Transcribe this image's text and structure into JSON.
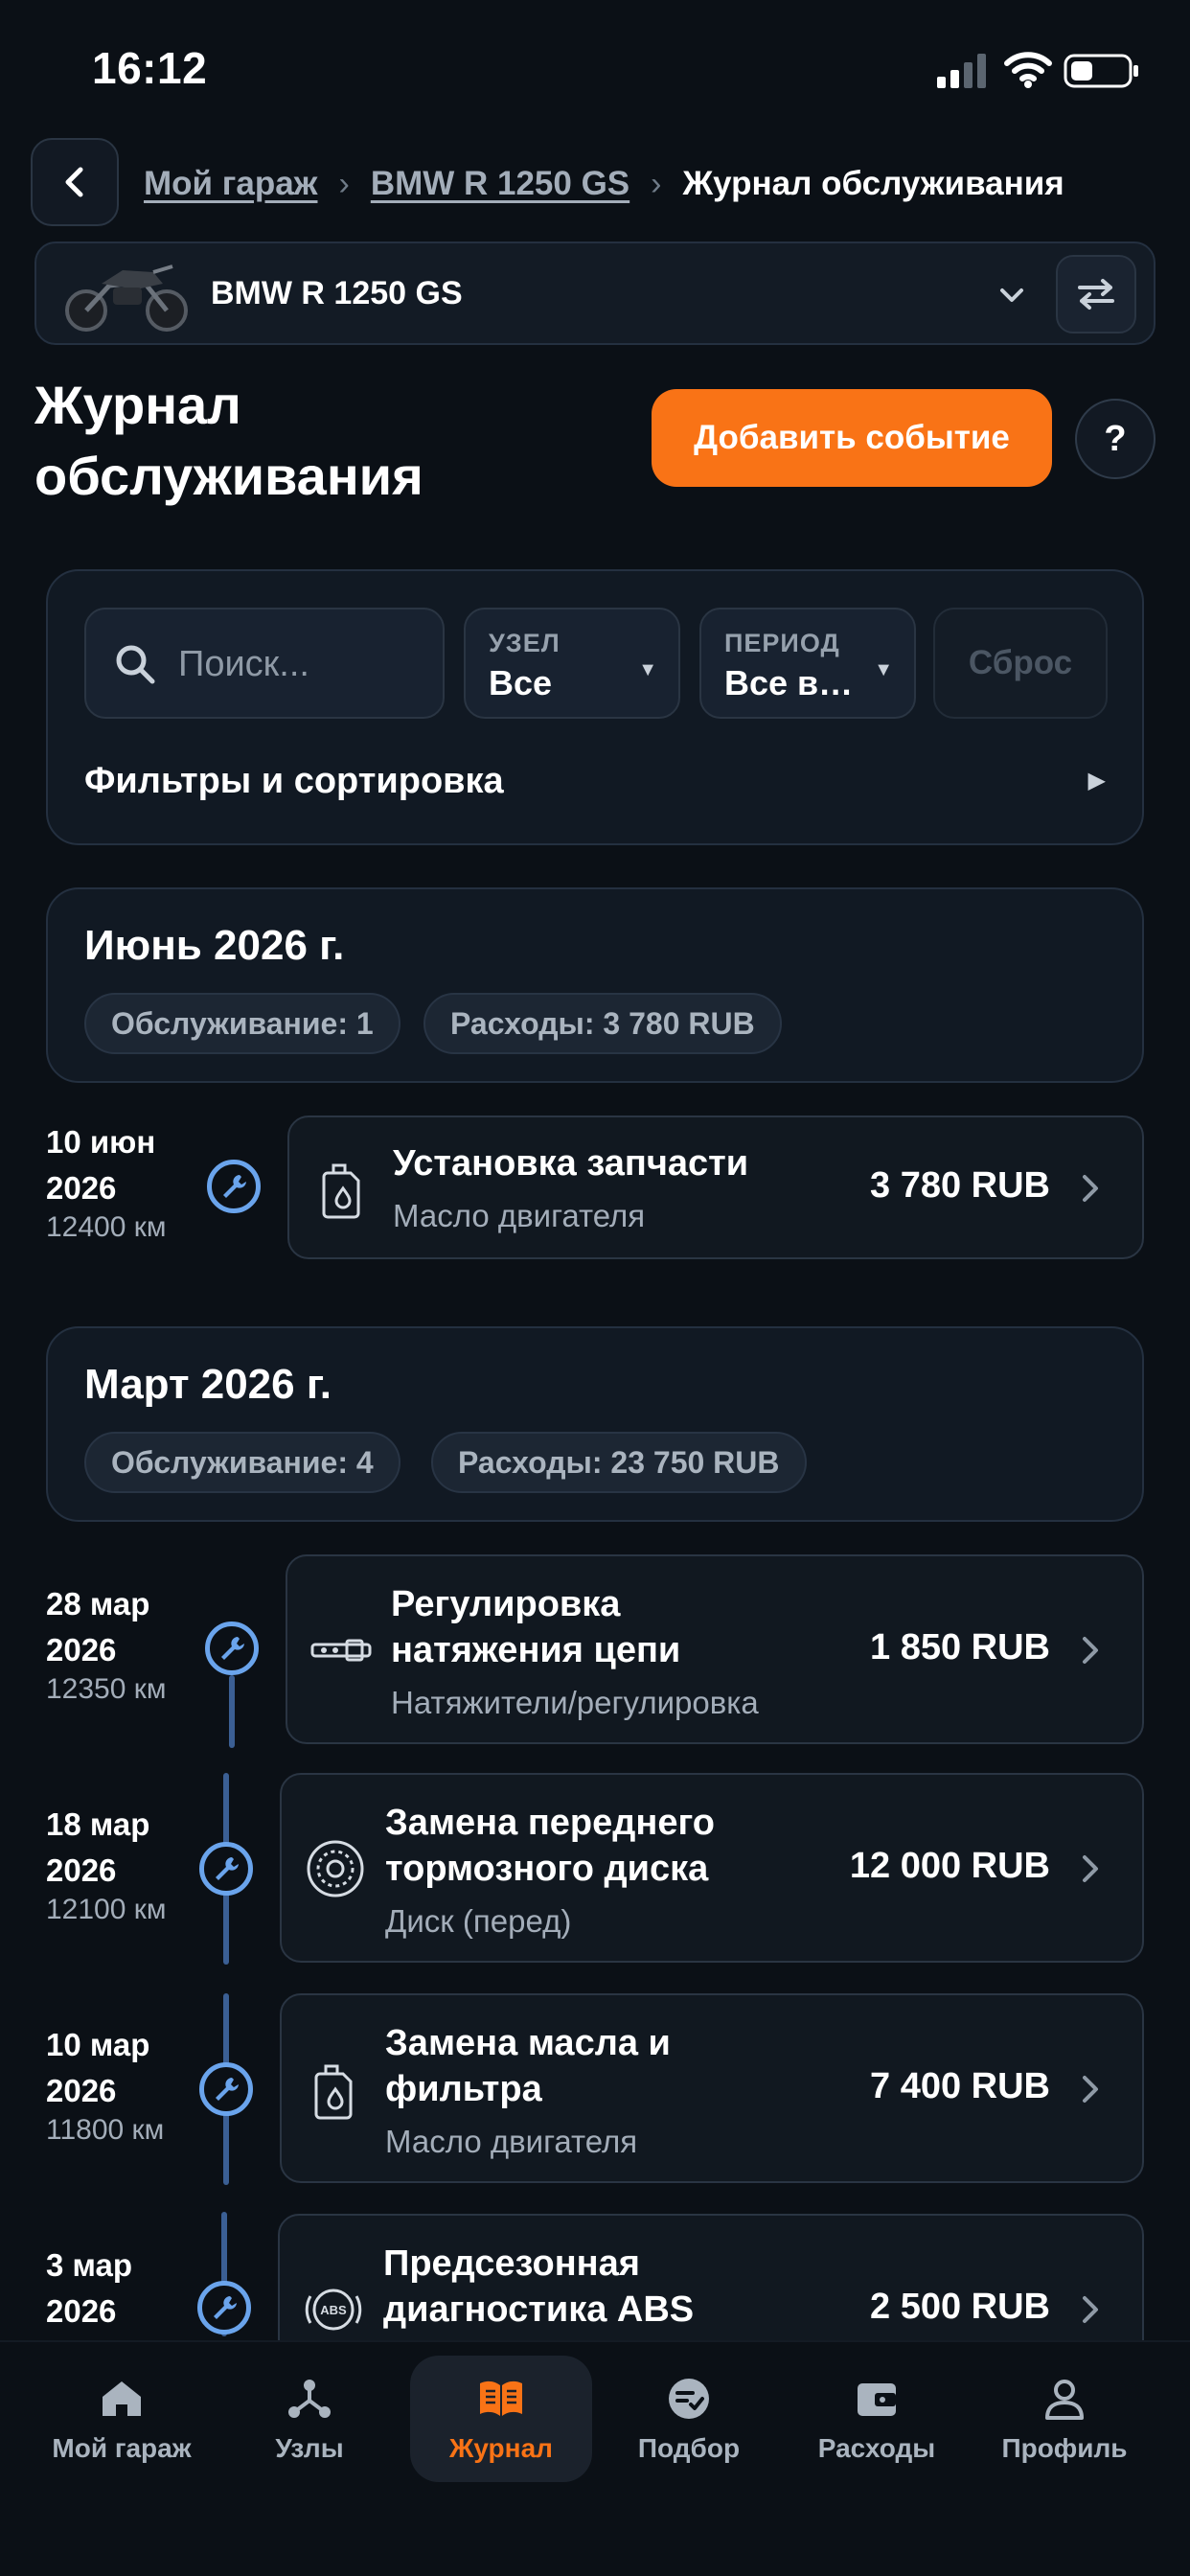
{
  "status_bar": {
    "time": "16:12"
  },
  "breadcrumb": {
    "items": [
      "Мой гараж",
      "BMW R 1250 GS"
    ],
    "current": "Журнал обслуживания",
    "separator": "›"
  },
  "bike": {
    "name": "BMW R 1250 GS"
  },
  "header": {
    "title": "Журнал обслуживания",
    "add_label": "Добавить событие",
    "help_label": "?"
  },
  "filters": {
    "search_placeholder": "Поиск...",
    "node": {
      "label": "УЗЕЛ",
      "value": "Все"
    },
    "period": {
      "label": "ПЕРИОД",
      "value": "Все в…"
    },
    "reset_label": "Сброс",
    "toggle_label": "Фильтры и сортировка"
  },
  "months": [
    {
      "title": "Июнь 2026 г.",
      "service": "Обслуживание: 1",
      "expenses": "Расходы: 3 780 RUB",
      "events": [
        {
          "date": "10 июн",
          "year": "2026",
          "km": "12400 км",
          "title": "Установка запчасти",
          "subtitle": "Масло двигателя",
          "amount": "3 780 RUB",
          "icon": "oil-can-icon"
        }
      ]
    },
    {
      "title": "Март 2026 г.",
      "service": "Обслуживание: 4",
      "expenses": "Расходы: 23 750 RUB",
      "events": [
        {
          "date": "28 мар",
          "year": "2026",
          "km": "12350 км",
          "title_1": "Регулировка",
          "title_2": "натяжения цепи",
          "subtitle": "Натяжители/регулировка",
          "amount": "1 850 RUB",
          "icon": "chain-tensioner-icon"
        },
        {
          "date": "18 мар",
          "year": "2026",
          "km": "12100 км",
          "title_1": "Замена переднего",
          "title_2": "тормозного диска",
          "subtitle": "Диск (перед)",
          "amount": "12 000 RUB",
          "icon": "brake-disc-icon"
        },
        {
          "date": "10 мар",
          "year": "2026",
          "km": "11800 км",
          "title_1": "Замена масла и",
          "title_2": "фильтра",
          "subtitle": "Масло двигателя",
          "amount": "7 400 RUB",
          "icon": "oil-can-icon"
        },
        {
          "date": "3 мар",
          "year": "2026",
          "km": "",
          "title_1": "Предсезонная",
          "title_2": "диагностика ABS",
          "subtitle": "",
          "amount": "2 500 RUB",
          "icon": "abs-icon",
          "icon_label": "ABS"
        }
      ]
    }
  ],
  "nav": {
    "items": [
      "Мой гараж",
      "Узлы",
      "Журнал",
      "Подбор",
      "Расходы",
      "Профиль"
    ],
    "active": "Журнал"
  },
  "colors": {
    "accent": "#f97316",
    "timeline": "#6aa4ec",
    "background": "#0b1016"
  }
}
